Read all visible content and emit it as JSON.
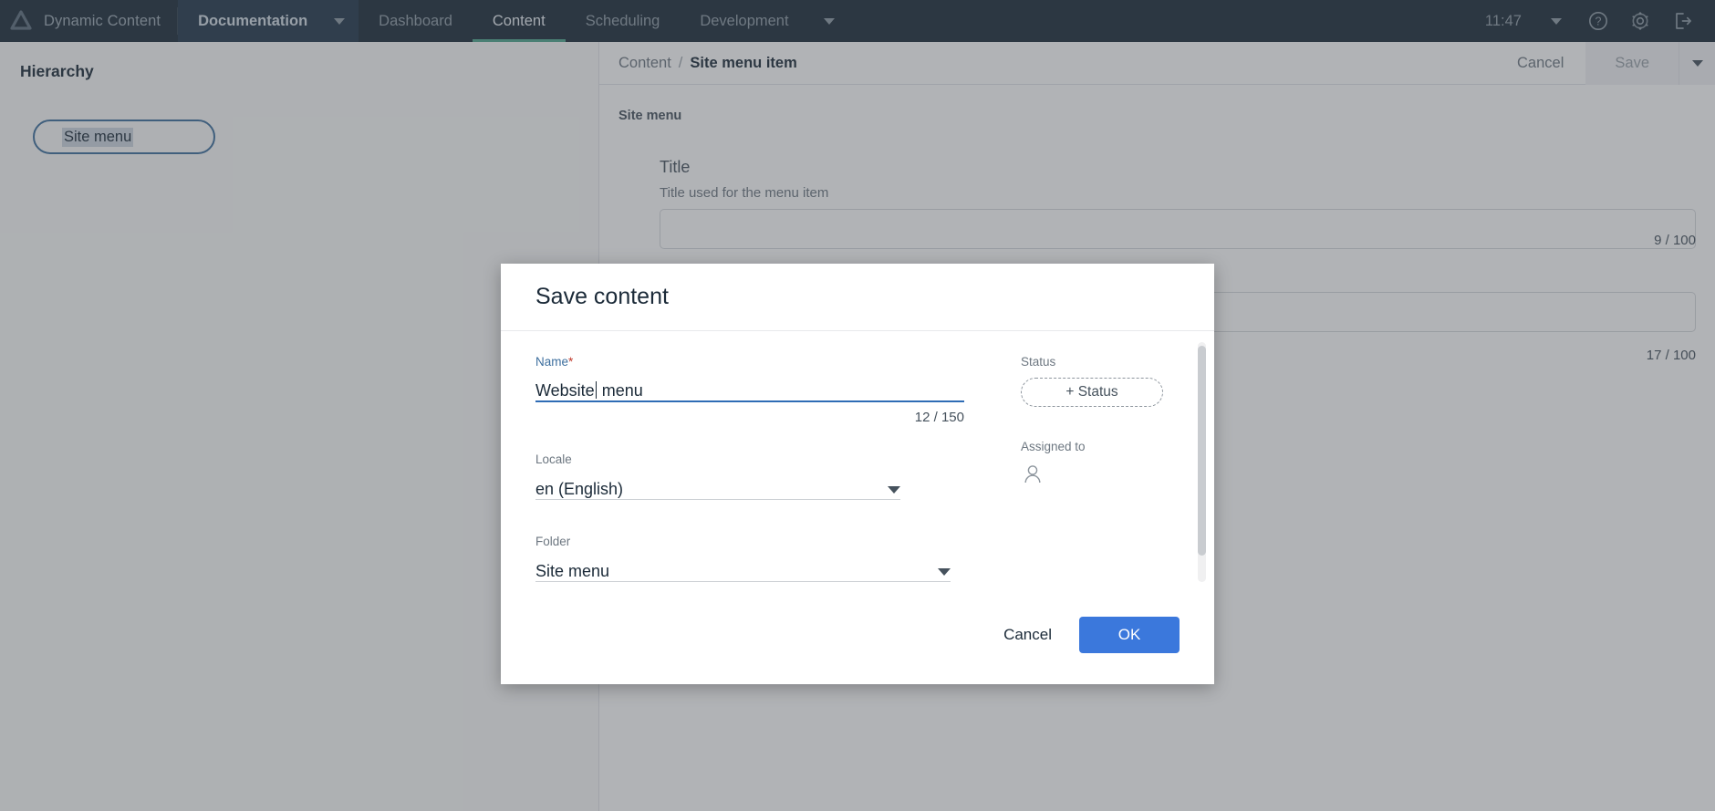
{
  "topnav": {
    "logo_icon": "triangle-logo-icon",
    "brand": "Dynamic Content",
    "project": "Documentation",
    "project_caret_icon": "chevron-down-icon",
    "items": [
      {
        "label": "Dashboard",
        "active": false
      },
      {
        "label": "Content",
        "active": true
      },
      {
        "label": "Scheduling",
        "active": false
      },
      {
        "label": "Development",
        "active": false
      }
    ],
    "development_caret_icon": "chevron-down-icon",
    "time": "11:47",
    "user_caret_icon": "chevron-down-icon",
    "help_icon": "help-circle-icon",
    "settings_icon": "gear-icon",
    "logout_icon": "logout-icon",
    "active_underline_color": "#4ea58e",
    "background_color": "#1b2a38"
  },
  "sidebar": {
    "title": "Hierarchy",
    "tree_item": "Site menu"
  },
  "main": {
    "breadcrumb": {
      "parent": "Content",
      "separator": "/",
      "current": "Site menu item"
    },
    "cancel_label": "Cancel",
    "save_label": "Save",
    "save_caret_icon": "chevron-down-icon",
    "section_label": "Site menu",
    "fields": [
      {
        "label": "Title",
        "help": "Title used for the menu item",
        "counter": "9 / 100"
      },
      {
        "label": "",
        "help": "",
        "counter": "17 / 100"
      }
    ]
  },
  "modal": {
    "title": "Save content",
    "name": {
      "label": "Name",
      "required_marker": "*",
      "value_before_caret": "Website",
      "value_after_caret": " menu",
      "counter": "12 / 150"
    },
    "locale": {
      "label": "Locale",
      "value": "en (English)",
      "caret_icon": "chevron-down-icon"
    },
    "folder": {
      "label": "Folder",
      "value": "Site menu",
      "caret_icon": "chevron-down-icon"
    },
    "status": {
      "label": "Status",
      "add_button": "+ Status"
    },
    "assigned": {
      "label": "Assigned to",
      "avatar_icon": "user-outline-icon"
    },
    "cancel_label": "Cancel",
    "ok_label": "OK",
    "primary_color": "#3b78dc",
    "focus_color": "#2f6cb5",
    "required_color": "#c0392b"
  }
}
